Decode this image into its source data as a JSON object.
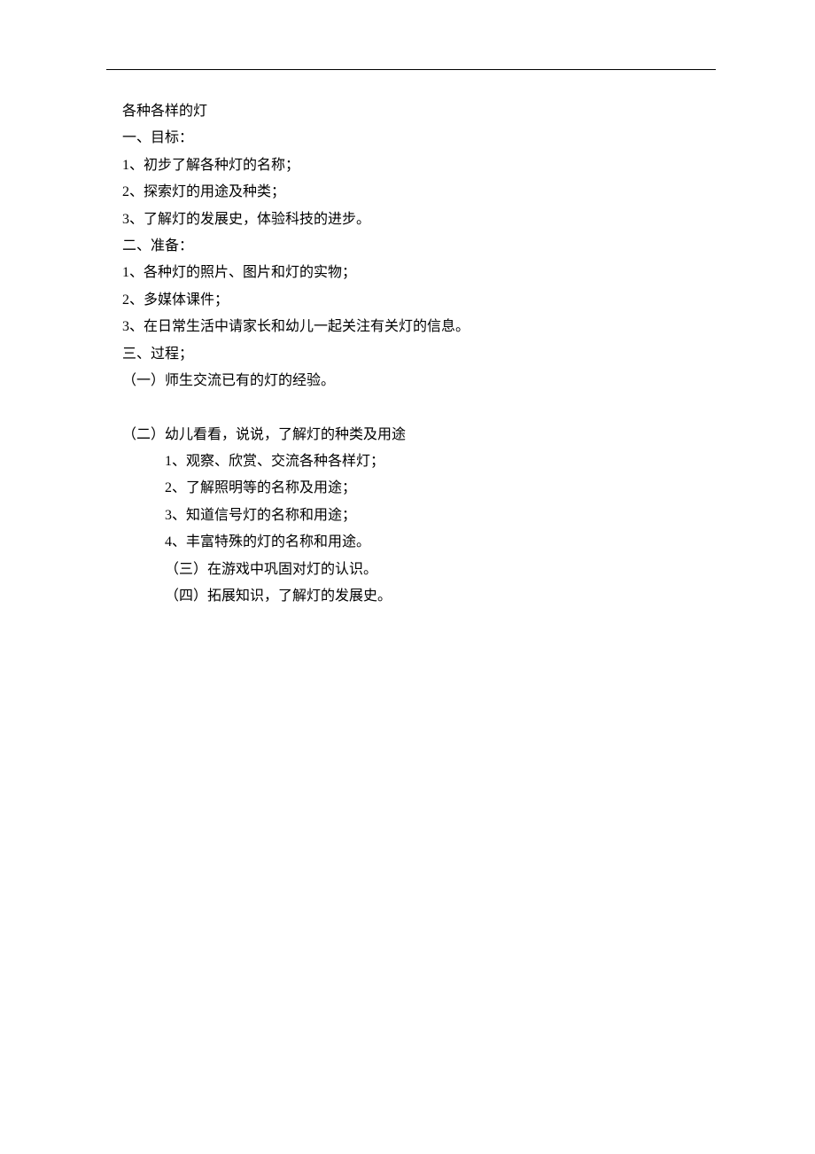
{
  "title": "各种各样的灯",
  "section1": {
    "heading": "一、目标：",
    "items": [
      "1、初步了解各种灯的名称；",
      "2、探索灯的用途及种类；",
      "3、了解灯的发展史，体验科技的进步。"
    ]
  },
  "section2": {
    "heading": "二、准备：",
    "items": [
      "1、各种灯的照片、图片和灯的实物；",
      "2、多媒体课件；",
      "3、在日常生活中请家长和幼儿一起关注有关灯的信息。"
    ]
  },
  "section3": {
    "heading": "三、过程；",
    "sub1": "（一）师生交流已有的灯的经验。",
    "sub2": {
      "heading": "（二）幼儿看看，说说，了解灯的种类及用途",
      "items": [
        "1、观察、欣赏、交流各种各样灯；",
        "2、了解照明等的名称及用途；",
        "3、知道信号灯的名称和用途；",
        "4、丰富特殊的灯的名称和用途。"
      ]
    },
    "sub3": "（三）在游戏中巩固对灯的认识。",
    "sub4": "（四）拓展知识，了解灯的发展史。"
  }
}
